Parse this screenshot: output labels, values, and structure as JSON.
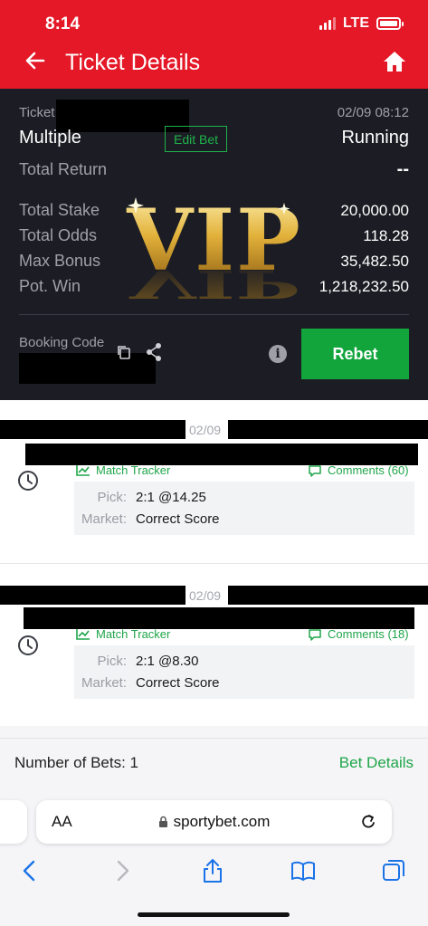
{
  "status": {
    "time": "8:14",
    "network": "LTE"
  },
  "header": {
    "title": "Ticket Details"
  },
  "ticket": {
    "ticket_label": "Ticket",
    "datetime": "02/09 08:12",
    "bet_type": "Multiple",
    "edit_bet_label": "Edit Bet",
    "status": "Running",
    "total_return_label": "Total Return",
    "total_return_value": "--",
    "rows": [
      {
        "label": "Total Stake",
        "value": "20,000.00"
      },
      {
        "label": "Total Odds",
        "value": "118.28"
      },
      {
        "label": "Max Bonus",
        "value": "35,482.50"
      },
      {
        "label": "Pot. Win",
        "value": "1,218,232.50"
      }
    ],
    "vip_text": "VIP",
    "booking_code_label": "Booking Code",
    "rebet_label": "Rebet"
  },
  "bets": [
    {
      "date": "02/09",
      "match_tracker_label": "Match Tracker",
      "comments_label": "Comments (60)",
      "pick_label": "Pick:",
      "pick_value": "2:1 @14.25",
      "market_label": "Market:",
      "market_value": "Correct Score"
    },
    {
      "date": "02/09",
      "match_tracker_label": "Match Tracker",
      "comments_label": "Comments (18)",
      "pick_label": "Pick:",
      "pick_value": "2:1 @8.30",
      "market_label": "Market:",
      "market_value": "Correct Score"
    }
  ],
  "footer": {
    "number_of_bets": "Number of Bets: 1",
    "bet_details_label": "Bet Details"
  },
  "browser": {
    "aa_label": "AA",
    "url": "sportybet.com"
  },
  "colors": {
    "brand_red": "#e41827",
    "panel_dark": "#1c1d24",
    "accent_green": "#12a53c",
    "vip_gold": "#d9a62b"
  },
  "icons": [
    "back-arrow-icon",
    "home-icon",
    "copy-icon",
    "share-icon",
    "info-icon",
    "clock-icon",
    "chart-icon",
    "comment-icon",
    "lock-icon",
    "reload-icon",
    "chevron-left-icon",
    "chevron-right-icon",
    "share-up-icon",
    "book-icon",
    "tabs-icon"
  ]
}
